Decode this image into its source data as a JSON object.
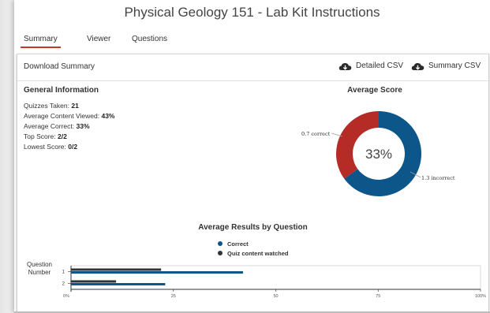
{
  "page": {
    "title": "Physical Geology 151 - Lab Kit Instructions"
  },
  "tabs": [
    {
      "label": "Summary",
      "active": true
    },
    {
      "label": "Viewer",
      "active": false
    },
    {
      "label": "Questions",
      "active": false
    }
  ],
  "toolbar": {
    "download_label": "Download Summary",
    "detailed_csv": "Detailed CSV",
    "summary_csv": "Summary CSV",
    "csv_icon": "cloud-download-icon"
  },
  "general_info": {
    "heading": "General Information",
    "rows": [
      {
        "label": "Quizzes Taken:",
        "value": "21"
      },
      {
        "label": "Average Content Viewed:",
        "value": "43%"
      },
      {
        "label": "Average Correct:",
        "value": "33%"
      },
      {
        "label": "Top Score:",
        "value": "2/2"
      },
      {
        "label": "Lowest Score:",
        "value": "0/2"
      }
    ]
  },
  "average_score": {
    "heading": "Average Score",
    "center_label": "33%",
    "correct_label": "0.7 correct",
    "incorrect_label": "1.3 incorrect",
    "correct_value": 0.7,
    "incorrect_value": 1.3,
    "colors": {
      "correct": "#b52b26",
      "incorrect": "#0d5689"
    }
  },
  "colors": {
    "accent": "#c0392b",
    "correct": "#0d5689",
    "watched": "#333333"
  },
  "chart_data": {
    "type": "bar",
    "orientation": "horizontal",
    "title": "Average Results by Question",
    "ylabel": "Question Number",
    "categories": [
      "1",
      "2"
    ],
    "series": [
      {
        "name": "Correct",
        "values": [
          42,
          23
        ],
        "color": "#0d5689"
      },
      {
        "name": "Quiz content watched",
        "values": [
          22,
          11
        ],
        "color": "#333333"
      }
    ],
    "xlim": [
      0,
      100
    ],
    "ticks": [
      "0%",
      "25",
      "50",
      "75",
      "100%"
    ],
    "tick_values": [
      0,
      25,
      50,
      75,
      100
    ],
    "grid": false,
    "legend_position": "top-center"
  }
}
